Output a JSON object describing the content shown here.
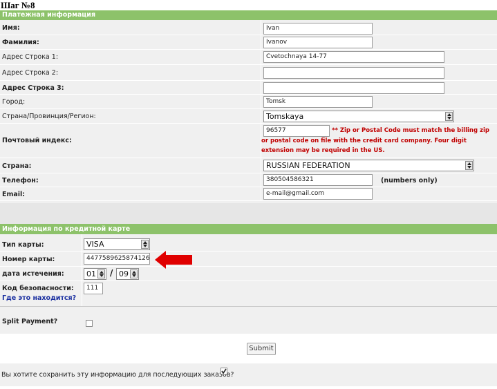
{
  "step_title": "Шаг №8",
  "billing": {
    "header": "Платежная информация",
    "first_name": {
      "label": "Имя:",
      "value": "Ivan"
    },
    "last_name": {
      "label": "Фамилия:",
      "value": "Ivanov"
    },
    "address1": {
      "label": "Адрес Строка 1:",
      "value": "Cvetochnaya 14-77"
    },
    "address2": {
      "label": "Адрес Строка 2:",
      "value": ""
    },
    "address3": {
      "label": "Адрес Строка 3:",
      "value": ""
    },
    "city": {
      "label": "Город:",
      "value": "Tomsk"
    },
    "region": {
      "label": "Страна/Провинция/Регион:",
      "value": "Tomskaya"
    },
    "postal": {
      "label": "Почтовый индекс:",
      "value": "96577",
      "note": "** Zip or Postal Code must match the billing zip or postal code on file with the credit card company. Four digit extension may be required in the US."
    },
    "country": {
      "label": "Страна:",
      "value": "RUSSIAN FEDERATION"
    },
    "phone": {
      "label": "Телефон:",
      "value": "380504586321",
      "hint": "(numbers only)"
    },
    "email": {
      "label": "Email:",
      "value": "e-mail@gmail.com"
    }
  },
  "card": {
    "header": "Информация по кредитной карте",
    "type": {
      "label": "Тип карты:",
      "value": "VISA"
    },
    "number": {
      "label": "Номер карты:",
      "value": "4477589625874126"
    },
    "expiry": {
      "label": "дата истечения:",
      "month": "01",
      "separator": "/",
      "year": "09"
    },
    "cvv": {
      "label": "Код безопасности:",
      "value": "111",
      "help_link": "Где это находится?"
    },
    "split": {
      "label": "Split Payment?",
      "checked": false
    }
  },
  "submit_label": "Submit",
  "save_info": {
    "label": "Вы хотите сохранить эту информацию для последующих заказов?",
    "checked": true
  },
  "colors": {
    "header_green": "#8dc26a",
    "band_gray": "#f0f0f0",
    "note_red": "#c00000",
    "link_blue": "#1a2fa0",
    "arrow_red": "#e00000"
  }
}
